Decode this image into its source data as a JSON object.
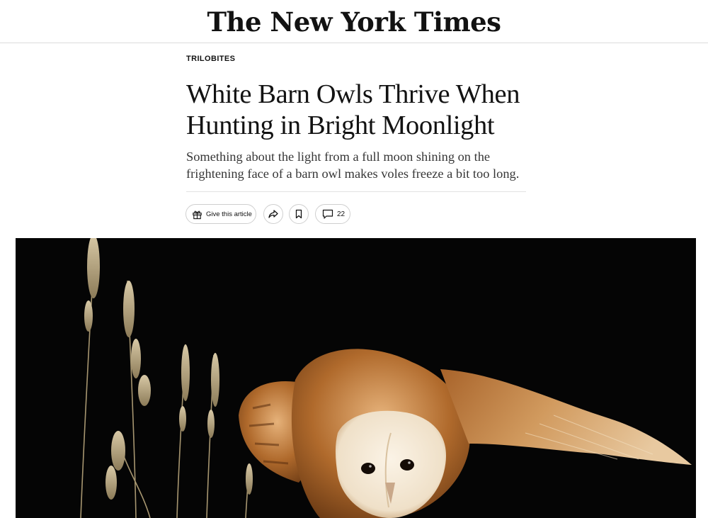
{
  "masthead": {
    "logo_text": "The New York Times"
  },
  "article": {
    "kicker": "TRILOBITES",
    "headline_line1": "White Barn Owls Thrive When",
    "headline_line2": "Hunting in Bright Moonlight",
    "dek_line1": "Something about the light from a full moon shining on the",
    "dek_line2": "frightening face of a barn owl makes voles freeze a bit too long."
  },
  "toolbar": {
    "gift_label": "Give this article",
    "gift_icon": "gift-icon",
    "share_icon": "share-arrow-icon",
    "save_icon": "bookmark-icon",
    "comments_icon": "speech-bubble-icon",
    "comments_count": "22"
  },
  "colors": {
    "text": "#121212",
    "dek": "#363636",
    "rule": "#e2e2e2",
    "photo_background": "#050505"
  }
}
